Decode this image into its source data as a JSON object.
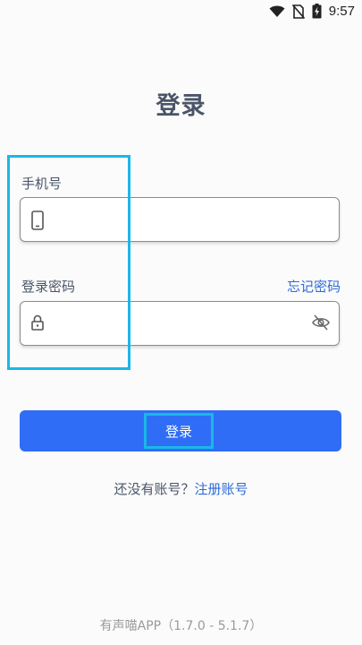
{
  "status_bar": {
    "time": "9:57",
    "icons": [
      "wifi-icon",
      "no-sim-icon",
      "battery-charging-icon"
    ]
  },
  "login": {
    "title": "登录",
    "phone_label": "手机号",
    "phone_value": "",
    "phone_icon": "phone-icon",
    "password_label": "登录密码",
    "password_value": "",
    "password_icon": "lock-icon",
    "visibility_icon": "eye-off-icon",
    "forgot_password": "忘记密码",
    "submit_label": "登录"
  },
  "register": {
    "prompt": "还没有账号？",
    "link": "注册账号"
  },
  "footer": {
    "version": "有声喵APP（1.7.0 - 5.1.7）"
  },
  "colors": {
    "accent": "#2f6df6",
    "link": "#2f6bd6",
    "highlight": "#1ab8e6",
    "title": "#4a5568"
  }
}
